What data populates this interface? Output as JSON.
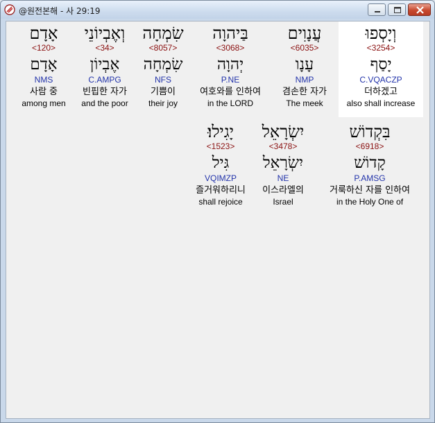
{
  "window": {
    "title": "@원전본해 - 사 29:19",
    "minimize_icon": "minimize-icon",
    "maximize_icon": "maximize-icon",
    "close_icon": "close-icon",
    "app_icon": "bible-app-icon"
  },
  "colors": {
    "strong": "#8a1010",
    "morph": "#2233aa",
    "highlight": "#ffffff"
  },
  "words": [
    {
      "heb": "וְיָסְפוּ",
      "strong": "<3254>",
      "lemma": "יָסַף",
      "morph": "C.VQACZP",
      "kor": "더하겠고",
      "eng": "also shall increase",
      "highlight": true
    },
    {
      "heb": "עֲנָוִים",
      "strong": "<6035>",
      "lemma": "עָנָו",
      "morph": "NMP",
      "kor": "겸손한 자가",
      "eng": "The meek",
      "highlight": false
    },
    {
      "heb": "בַּיהוָה",
      "strong": "<3068>",
      "lemma": "יְהוָה",
      "morph": "P.NE",
      "kor": "여호와를 인하여",
      "eng": "in the LORD",
      "highlight": false
    },
    {
      "heb": "שִׂמְחָה",
      "strong": "<8057>",
      "lemma": "שִׂמְחָה",
      "morph": "NFS",
      "kor": "기쁨이",
      "eng": "their joy",
      "highlight": false
    },
    {
      "heb": "וְאֶבְיוֹנֵי",
      "strong": "<34>",
      "lemma": "אֶבְיוֹן",
      "morph": "C.AMPG",
      "kor": "빈핍한 자가",
      "eng": "and the poor",
      "highlight": false
    },
    {
      "heb": "אָדָם",
      "strong": "<120>",
      "lemma": "אָדָם",
      "morph": "NMS",
      "kor": "사람 중",
      "eng": "among men",
      "highlight": false
    },
    {
      "heb": "בִּקְדוֹשׁ",
      "strong": "<6918>",
      "lemma": "קָדוֹשׁ",
      "morph": "P.AMSG",
      "kor": "거룩하신 자를 인하여",
      "eng": "in the Holy One of",
      "highlight": false
    },
    {
      "heb": "יִשְׂרָאֵל",
      "strong": "<3478>",
      "lemma": "יִשְׂרָאֵל",
      "morph": "NE",
      "kor": "이스라엘의",
      "eng": "Israel",
      "highlight": false
    },
    {
      "heb": "יָגִילוּ׃",
      "strong": "<1523>",
      "lemma": "גִּיל",
      "morph": "VQIMZP",
      "kor": "즐거워하리니",
      "eng": "shall rejoice",
      "highlight": false
    }
  ]
}
